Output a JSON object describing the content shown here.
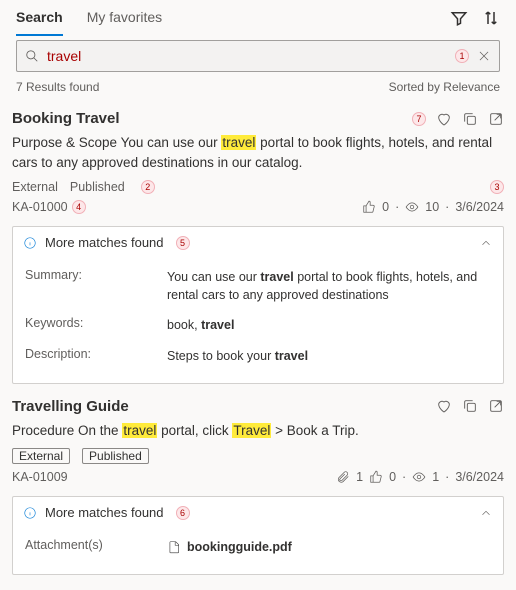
{
  "tabs": {
    "search": "Search",
    "favorites": "My favorites"
  },
  "search": {
    "value": "travel"
  },
  "meta": {
    "count": "7 Results found",
    "sort": "Sorted by Relevance"
  },
  "r1": {
    "title": "Booking Travel",
    "snip_a": "Purpose & Scope You can use our ",
    "snip_hl": "travel",
    "snip_b": " portal to book flights, hotels, and rental cars to any approved destinations in our catalog.",
    "tag1": "External",
    "tag2": "Published",
    "ka": "KA-01000",
    "likes": "0",
    "views": "10",
    "date": "3/6/2024",
    "more_label": "More matches found",
    "sum_k": "Summary:",
    "sum_v_a": "You can use our ",
    "sum_v_b1": "travel",
    "sum_v_b": " portal to book flights, hotels, and rental cars to any approved destinations",
    "key_k": "Keywords:",
    "key_v_a": "book, ",
    "key_v_b": "travel",
    "desc_k": "Description:",
    "desc_v_a": "Steps to book your ",
    "desc_v_b": "travel"
  },
  "r2": {
    "title": "Travelling Guide",
    "snip_a": "Procedure On the ",
    "snip_h1": "travel",
    "snip_b": " portal, click ",
    "snip_h2": "Travel",
    "snip_c": " > Book a Trip.",
    "tag1": "External",
    "tag2": "Published",
    "ka": "KA-01009",
    "att": "1",
    "likes": "0",
    "views": "1",
    "date": "3/6/2024",
    "more_label": "More matches found",
    "att_k": "Attachment(s)",
    "att_v": "bookingguide.pdf"
  },
  "co": {
    "c1": "1",
    "c2": "2",
    "c3": "3",
    "c4": "4",
    "c5": "5",
    "c6": "6",
    "c7": "7"
  }
}
